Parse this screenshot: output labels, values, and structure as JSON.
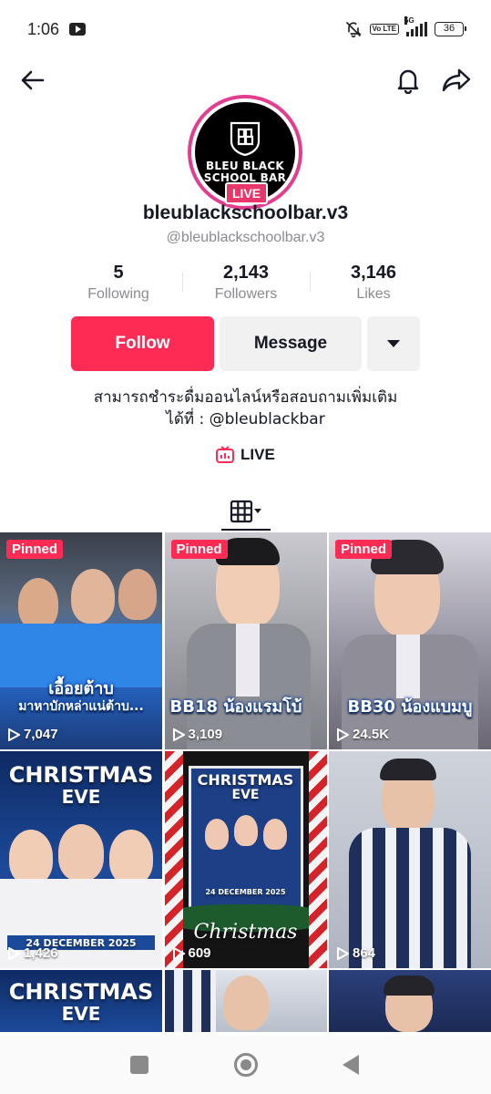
{
  "status_bar": {
    "time": "1:06",
    "network": "5G",
    "volte": "Vo LTE",
    "battery": "36"
  },
  "profile": {
    "avatar_line1": "BLEU BLACK",
    "avatar_line2": "SCHOOL BAR",
    "live_badge": "LIVE",
    "display_name": "bleublackschoolbar.v3",
    "handle": "@bleublackschoolbar.v3"
  },
  "stats": [
    {
      "value": "5",
      "label": "Following"
    },
    {
      "value": "2,143",
      "label": "Followers"
    },
    {
      "value": "3,146",
      "label": "Likes"
    }
  ],
  "actions": {
    "follow": "Follow",
    "message": "Message"
  },
  "bio": {
    "line1": "สามารถชำระดื่มออนไลน์หรือสอบถามเพิ่มเติม",
    "line2": "ได้ที่ : @bleublackbar"
  },
  "live_link": "LIVE",
  "videos": [
    {
      "pinned": "Pinned",
      "caption1": "เอื้อยต้าบ",
      "caption2": "มาหาบักหล่าแน่ต้าบ...",
      "views": "7,047"
    },
    {
      "pinned": "Pinned",
      "caption1": "BB18 น้องแรมโบ้",
      "views": "3,109"
    },
    {
      "pinned": "Pinned",
      "caption1": "BB30 น้องแบมบู",
      "views": "24.5K"
    },
    {
      "title": "CHRISTMAS",
      "subtitle": "EVE",
      "date": "24 DECEMBER 2025",
      "views": "1,426"
    },
    {
      "title": "CHRISTMAS",
      "subtitle": "EVE",
      "date": "24 DECEMBER 2025",
      "script": "Christmas",
      "views": "609"
    },
    {
      "views": "864"
    },
    {
      "title": "CHRISTMAS",
      "subtitle": "EVE"
    },
    {},
    {}
  ],
  "colors": {
    "accent": "#fe2c55",
    "live_pink": "#e8376d",
    "ring": "#e33d8f"
  }
}
